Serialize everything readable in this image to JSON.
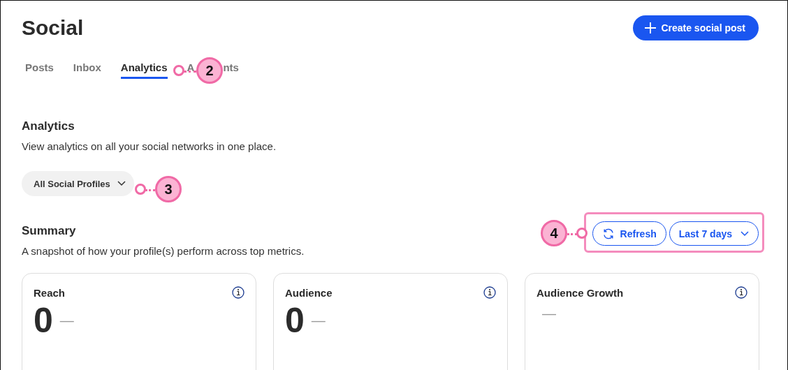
{
  "page_title": "Social",
  "create_button": {
    "label": "Create social post"
  },
  "tabs": [
    {
      "label": "Posts",
      "selected": false
    },
    {
      "label": "Inbox",
      "selected": false
    },
    {
      "label": "Analytics",
      "selected": true
    },
    {
      "label_parts": [
        "A",
        "nts"
      ],
      "selected": false
    }
  ],
  "analytics": {
    "title": "Analytics",
    "description": "View analytics on all your social networks in one place.",
    "profile_select": {
      "value": "All Social Profiles"
    }
  },
  "summary": {
    "title": "Summary",
    "description": "A snapshot of how your profile(s) perform across top metrics.",
    "refresh_button": {
      "label": "Refresh"
    },
    "range_select": {
      "value": "Last 7 days"
    }
  },
  "metrics": [
    {
      "title": "Reach",
      "value": "0",
      "change": "—"
    },
    {
      "title": "Audience",
      "value": "0",
      "change": "—"
    },
    {
      "title": "Audience Growth",
      "change": "—"
    }
  ],
  "callouts": [
    {
      "number": "2"
    },
    {
      "number": "3"
    },
    {
      "number": "4"
    }
  ]
}
